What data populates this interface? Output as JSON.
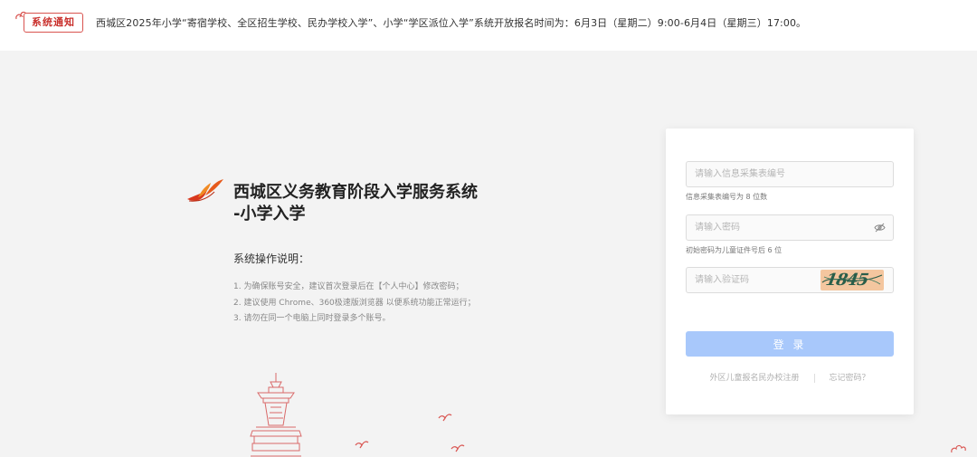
{
  "notice": {
    "badge": "系统通知",
    "text": "西城区2025年小学“寄宿学校、全区招生学校、民办学校入学”、小学“学区派位入学”系统开放报名时间为：6月3日（星期二）9:00-6月4日（星期三）17:00。"
  },
  "brand": {
    "title_line1": "西城区义务教育阶段入学服务系统",
    "title_line2": "-小学入学",
    "logo_icon": "leaf-logo-icon"
  },
  "instructions": {
    "title": "系统操作说明：",
    "items": [
      "1. 为确保账号安全，建议首次登录后在【个人中心】修改密码；",
      "2. 建议使用 Chrome、360极速版浏览器 以便系统功能正常运行；",
      "3. 请勿在同一个电脑上同时登录多个账号。"
    ]
  },
  "login": {
    "form_no_placeholder": "请输入信息采集表编号",
    "form_no_value": "",
    "form_no_hint": "信息采集表编号为 8 位数",
    "password_placeholder": "请输入密码",
    "password_value": "",
    "password_hint": "初始密码为儿童证件号后 6 位",
    "captcha_placeholder": "请输入验证码",
    "captcha_value": "",
    "captcha_image_text": "1845",
    "login_label": "登 录",
    "register_link": "外区儿童报名民办校注册",
    "forgot_link": "忘记密码？"
  },
  "colors": {
    "accent_red": "#c9302c",
    "button_blue": "#a8c8fb",
    "background": "#f3f3f3"
  }
}
